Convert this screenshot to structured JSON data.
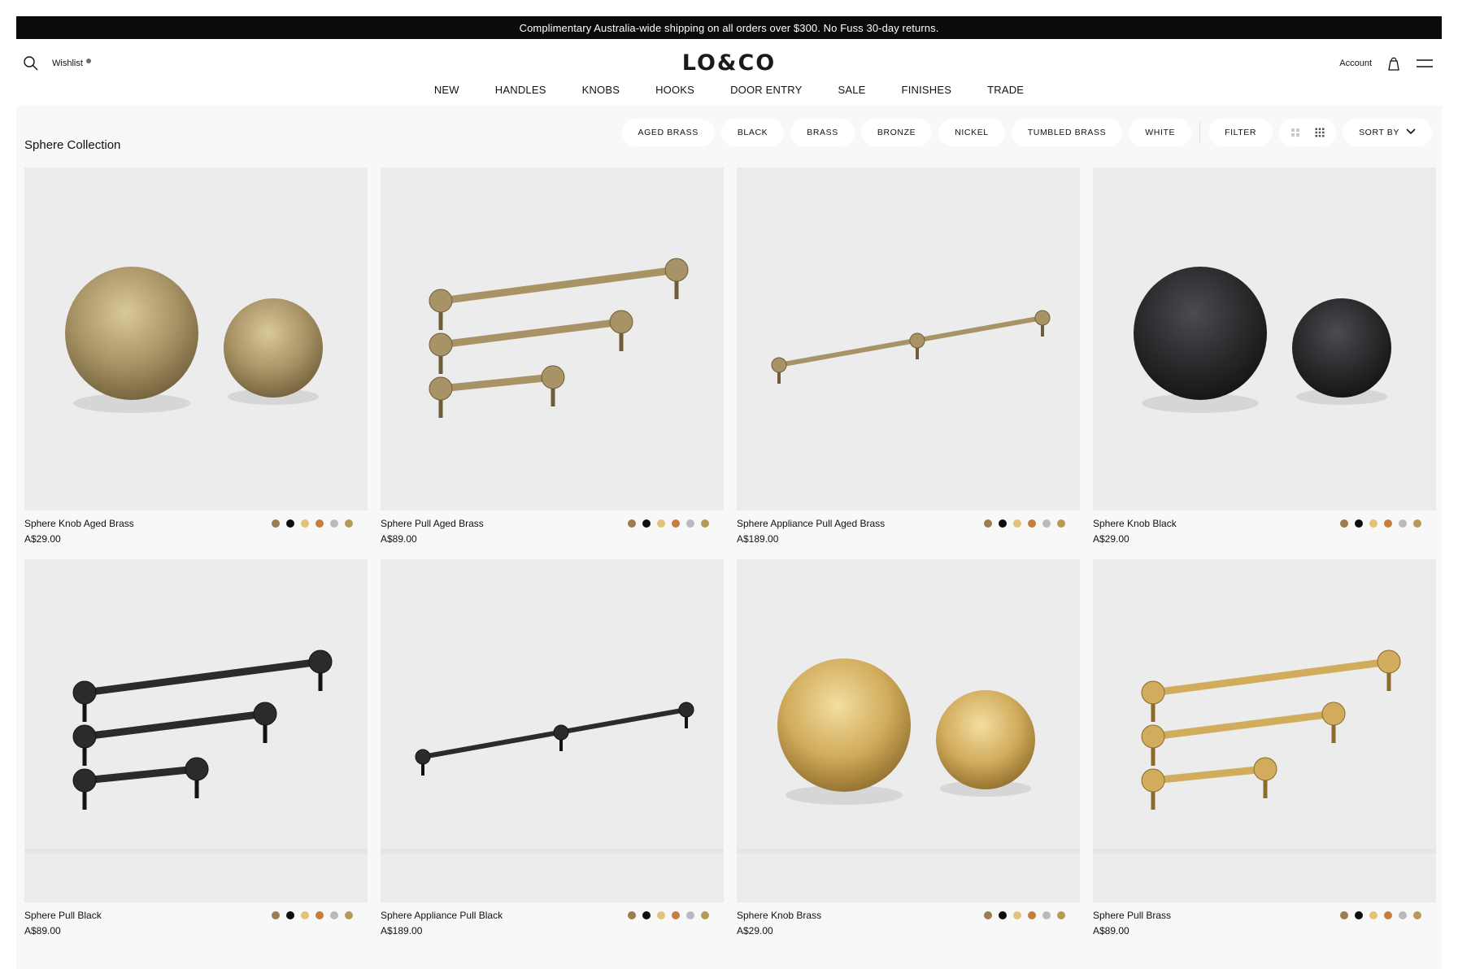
{
  "announcement": "Complimentary Australia-wide shipping on all orders over $300. No Fuss 30-day returns.",
  "header": {
    "wishlist_label": "Wishlist",
    "logo": "LO&CO",
    "account_label": "Account"
  },
  "nav": [
    "NEW",
    "HANDLES",
    "KNOBS",
    "HOOKS",
    "DOOR ENTRY",
    "SALE",
    "FINISHES",
    "TRADE"
  ],
  "collection_title": "Sphere Collection",
  "filters": [
    "AGED BRASS",
    "BLACK",
    "BRASS",
    "BRONZE",
    "NICKEL",
    "TUMBLED BRASS",
    "WHITE"
  ],
  "filter_label": "FILTER",
  "sort_label": "SORT BY",
  "swatch_colors": [
    "#9b7d4e",
    "#0e0e0e",
    "#e3c178",
    "#c47f3f",
    "#b9babd",
    "#b89a57"
  ],
  "products": [
    {
      "name": "Sphere Knob Aged Brass",
      "price": "A$29.00",
      "art": "knobs",
      "finish": "aged"
    },
    {
      "name": "Sphere Pull Aged Brass",
      "price": "A$89.00",
      "art": "pulls",
      "finish": "aged"
    },
    {
      "name": "Sphere Appliance Pull Aged Brass",
      "price": "A$189.00",
      "art": "appliance",
      "finish": "aged"
    },
    {
      "name": "Sphere Knob Black",
      "price": "A$29.00",
      "art": "knobs",
      "finish": "black"
    },
    {
      "name": "Sphere Pull Black",
      "price": "A$89.00",
      "art": "pulls",
      "finish": "black"
    },
    {
      "name": "Sphere Appliance Pull Black",
      "price": "A$189.00",
      "art": "appliance",
      "finish": "black"
    },
    {
      "name": "Sphere Knob Brass",
      "price": "A$29.00",
      "art": "knobs",
      "finish": "brass"
    },
    {
      "name": "Sphere Pull Brass",
      "price": "A$89.00",
      "art": "pulls",
      "finish": "brass"
    }
  ],
  "icons": {
    "search": "search-icon",
    "bag": "bag-icon",
    "menu": "menu-icon",
    "grid_large": "grid-large-icon",
    "grid_small": "grid-small-icon",
    "chevron": "chevron-down-icon"
  }
}
